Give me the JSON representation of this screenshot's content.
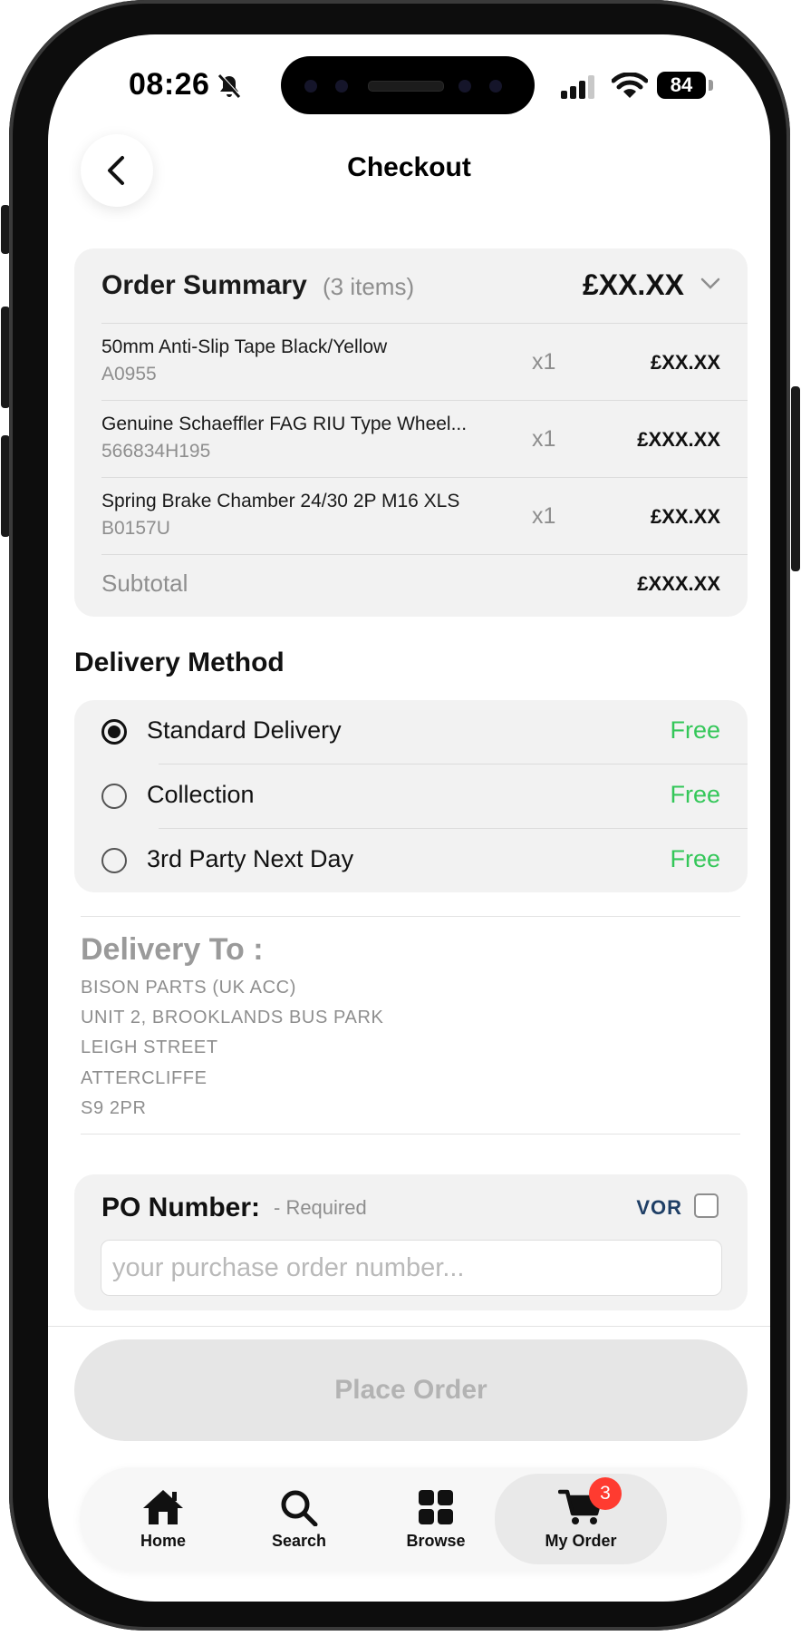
{
  "status_bar": {
    "time": "08:26",
    "battery": "84"
  },
  "header": {
    "title": "Checkout"
  },
  "order_summary": {
    "title": "Order Summary",
    "count": "(3 items)",
    "total": "£XX.XX",
    "items": [
      {
        "name": "50mm Anti-Slip Tape Black/Yellow",
        "code": "A0955",
        "qty": "x1",
        "price": "£XX.XX"
      },
      {
        "name": "Genuine Schaeffler FAG RIU Type Wheel...",
        "code": "566834H195",
        "qty": "x1",
        "price": "£XXX.XX"
      },
      {
        "name": "Spring Brake Chamber 24/30 2P M16 XLS",
        "code": "B0157U",
        "qty": "x1",
        "price": "£XX.XX"
      }
    ],
    "subtotal_label": "Subtotal",
    "subtotal_value": "£XXX.XX"
  },
  "delivery_method": {
    "title": "Delivery Method",
    "selected": "Standard Delivery",
    "options": [
      {
        "label": "Standard Delivery",
        "price": "Free"
      },
      {
        "label": "Collection",
        "price": "Free"
      },
      {
        "label": "3rd Party Next Day",
        "price": "Free"
      }
    ]
  },
  "delivery_to": {
    "title": "Delivery To :",
    "lines": [
      "BISON PARTS (UK ACC)",
      "UNIT 2, BROOKLANDS BUS PARK",
      "LEIGH STREET",
      "ATTERCLIFFE",
      "S9 2PR"
    ]
  },
  "po": {
    "label": "PO Number:",
    "required": "- Required",
    "vor_label": "VOR",
    "vor_checked": false,
    "value": "",
    "placeholder": "your purchase order number..."
  },
  "place_order": {
    "label": "Place Order",
    "enabled": false
  },
  "tabbar": {
    "active": "My Order",
    "items": [
      {
        "label": "Home",
        "icon": "home-icon"
      },
      {
        "label": "Search",
        "icon": "search-icon"
      },
      {
        "label": "Browse",
        "icon": "grid-icon"
      },
      {
        "label": "My Order",
        "icon": "cart-icon",
        "badge": "3"
      }
    ]
  },
  "colors": {
    "accent_free": "#34c759",
    "badge": "#ff3b30",
    "vor": "#1f3f66"
  }
}
